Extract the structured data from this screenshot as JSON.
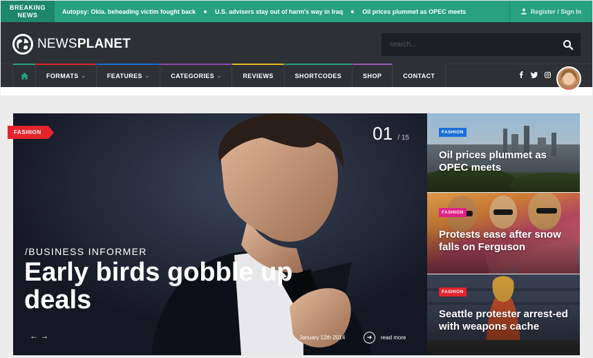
{
  "breaking": {
    "label_line1": "BREAKING",
    "label_line2": "NEWS",
    "items": [
      "Autopsy: Okla. beheading victim fought back",
      "U.S. advisers stay out of harm's way in Iraq",
      "Oil prices plummet as OPEC meets"
    ],
    "login": "Register / Sign In"
  },
  "header": {
    "logo_light": "NEWS",
    "logo_bold": "PLANET",
    "search_placeholder": "search..."
  },
  "nav": {
    "items": [
      {
        "label": "FORMATS",
        "dropdown": true,
        "accent": "#e3242b"
      },
      {
        "label": "FEATURES",
        "dropdown": true,
        "accent": "#1a6fd8"
      },
      {
        "label": "CATEGORIES",
        "dropdown": true,
        "accent": "#8e44ad"
      },
      {
        "label": "REVIEWS",
        "dropdown": false,
        "accent": "#e7b92a"
      },
      {
        "label": "SHORTCODES",
        "dropdown": false,
        "accent": "#27a17e"
      },
      {
        "label": "SHOP",
        "dropdown": false,
        "accent": "#9b59b6"
      },
      {
        "label": "CONTACT",
        "dropdown": false,
        "accent": "#2d3035"
      }
    ],
    "chevron": "⌄",
    "home_accent": "#27a17e"
  },
  "slider": {
    "tag": "FASHION",
    "counter_current": "01",
    "counter_total": "/ 15",
    "kicker": "/BUSINESS INFORMER",
    "headline": "Early birds gobble up deals",
    "arrows": "← →",
    "date": "January 12th 2014",
    "read_more": "read more"
  },
  "side": [
    {
      "tag": "FASHION",
      "tag_color": "#1a6fd8",
      "title": "Oil prices plummet as OPEC meets"
    },
    {
      "tag": "FASHION",
      "tag_color": "#e0218a",
      "title": "Protests ease after snow falls on Ferguson"
    },
    {
      "tag": "FASHION",
      "tag_color": "#e3242b",
      "title": "Seattle protester arrest-ed with weapons cache"
    }
  ]
}
